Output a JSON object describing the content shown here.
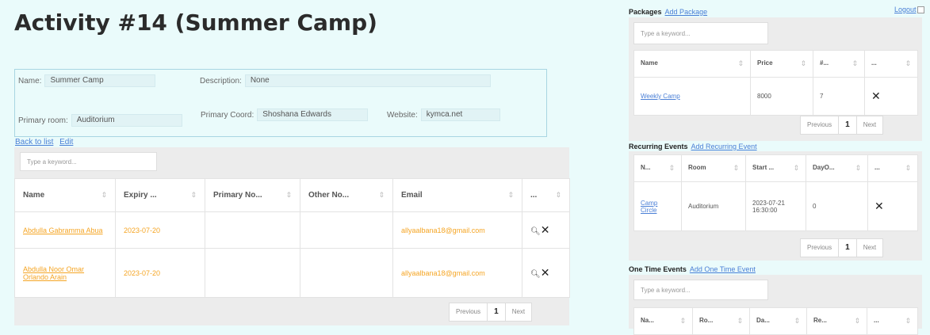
{
  "title": "Activity #14 (Summer Camp)",
  "details": {
    "name_label": "Name:",
    "name_value": "Summer Camp",
    "description_label": "Description:",
    "description_value": "None",
    "primary_room_label": "Primary room:",
    "primary_room_value": "Auditorium",
    "primary_coord_label": "Primary Coord:",
    "primary_coord_value": "Shoshana Edwards",
    "website_label": "Website:",
    "website_value": "kymca.net"
  },
  "links": {
    "back": "Back to list",
    "edit": "Edit"
  },
  "participants": {
    "search_placeholder": "Type a keyword...",
    "columns": [
      "Name",
      "Expiry ...",
      "Primary No...",
      "Other No...",
      "Email",
      "..."
    ],
    "rows": [
      {
        "name": "Abdulla Gabramma Abua",
        "expiry": "2023-07-20",
        "primary": "",
        "other": "",
        "email": "allyaalbana18@gmail.com"
      },
      {
        "name": "Abdulla Noor Omar Orlando Arain",
        "expiry": "2023-07-20",
        "primary": "",
        "other": "",
        "email": "allyaalbana18@gmail.com"
      }
    ],
    "pager": {
      "previous": "Previous",
      "current": "1",
      "next": "Next"
    }
  },
  "logout": "Logout",
  "packages": {
    "heading": "Packages",
    "add_link": "Add Package",
    "search_placeholder": "Type a keyword...",
    "columns": [
      "Name",
      "Price",
      "#...",
      "..."
    ],
    "rows": [
      {
        "name": "Weekly Camp",
        "price": "8000",
        "count": "7"
      }
    ],
    "pager": {
      "previous": "Previous",
      "current": "1",
      "next": "Next"
    }
  },
  "recurring": {
    "heading": "Recurring Events",
    "add_link": "Add Recurring Event",
    "columns": [
      "N...",
      "Room",
      "Start ...",
      "DayO...",
      "..."
    ],
    "rows": [
      {
        "name": "Camp Circle",
        "room": "Auditorium",
        "start": "2023-07-21 16:30:00",
        "dayof": "0"
      }
    ],
    "pager": {
      "previous": "Previous",
      "current": "1",
      "next": "Next"
    }
  },
  "onetime": {
    "heading": "One Time Events",
    "add_link": "Add One Time Event",
    "search_placeholder": "Type a keyword...",
    "columns": [
      "Na...",
      "Ro...",
      "Da...",
      "Re...",
      "..."
    ]
  },
  "icons": {
    "remove": "close-icon",
    "view": "magnifier-icon",
    "sort": "sort-arrows-icon"
  },
  "colors": {
    "background": "#eafbfb",
    "link": "#4a7fd6",
    "participant_text": "#f5a524",
    "panel": "#ececec"
  }
}
